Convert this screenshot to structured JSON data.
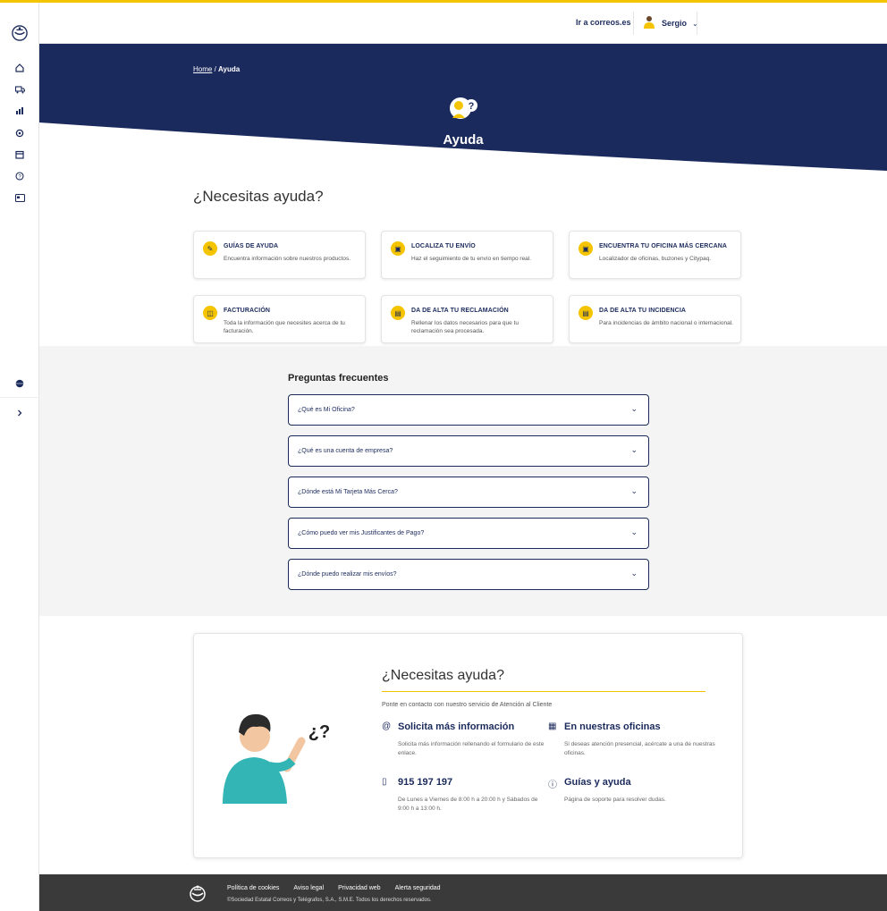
{
  "header": {
    "ir_link": "Ir a correos.es",
    "user_name": "Sergio"
  },
  "hero": {
    "breadcrumb_home": "Home",
    "breadcrumb_sep": " / ",
    "breadcrumb_current": "Ayuda",
    "title": "Ayuda"
  },
  "help": {
    "title": "¿Necesitas ayuda?",
    "cards": [
      {
        "title": "GUÍAS DE AYUDA",
        "desc": "Encuentra información sobre nuestros productos.",
        "icon": "guide-icon"
      },
      {
        "title": "LOCALIZA TU ENVÍO",
        "desc": "Haz el seguimiento de tu envío en tiempo real.",
        "icon": "package-icon"
      },
      {
        "title": "ENCUENTRA TU OFICINA MÁS CERCANA",
        "desc": "Localizador de oficinas, buzones y Citypaq.",
        "icon": "office-icon"
      },
      {
        "title": "FACTURACIÓN",
        "desc": "Toda la información que necesites acerca de tu facturación.",
        "icon": "invoice-icon"
      },
      {
        "title": "DA DE ALTA TU RECLAMACIÓN",
        "desc": "Rellenar los datos necesarios para que tu reclamación sea procesada.",
        "icon": "claim-icon"
      },
      {
        "title": "DA DE ALTA TU INCIDENCIA",
        "desc": "Para incidencias de ámbito nacional o internacional.",
        "icon": "incident-icon"
      }
    ]
  },
  "faq": {
    "title": "Preguntas frecuentes",
    "items": [
      "¿Qué es Mi Oficina?",
      "¿Qué es una cuenta de empresa?",
      "¿Dónde está Mi Tarjeta Más Cerca?",
      "¿Cómo puedo ver mis Justificantes de Pago?",
      "¿Dónde puedo realizar mis envíos?"
    ]
  },
  "contact": {
    "title": "¿Necesitas ayuda?",
    "subtitle": "Ponte en contacto con nuestro servicio de Atención al Cliente",
    "blocks": [
      {
        "head": "Solicita más información",
        "text": "Solicita más información rellenando el formulario de este enlace.",
        "icon": "at-icon"
      },
      {
        "head": "En nuestras oficinas",
        "text": "Si deseas atención presencial, acércate a una de nuestras oficinas.",
        "icon": "building-icon"
      },
      {
        "head": "915 197 197",
        "text": "De Lunes a Viernes de 8:00 h a 20:00 h y Sábados de 9:00 h a 13:00 h.",
        "icon": "phone-icon"
      },
      {
        "head": "Guías y ayuda",
        "text": "Página de soporte para resolver dudas.",
        "icon": "help-circle-icon"
      }
    ],
    "illus_text": "¿?"
  },
  "footer": {
    "links": [
      "Política de cookies",
      "Aviso legal",
      "Privacidad web",
      "Alerta seguridad"
    ],
    "copyright": "©Sociedad Estatal Correos y Telégrafos, S.A., S.M.E. Todos los derechos reservados."
  },
  "colors": {
    "brand_blue": "#1b2a5c",
    "brand_yellow": "#f5c400"
  }
}
